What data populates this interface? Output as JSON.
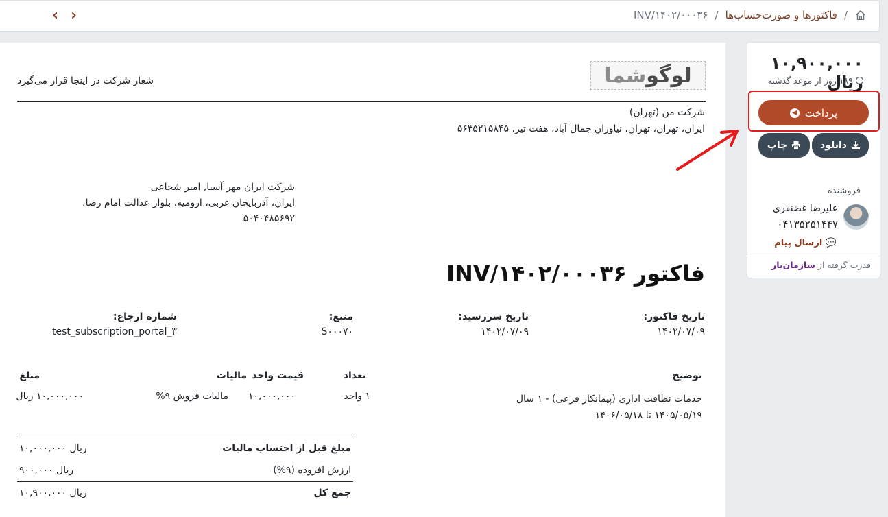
{
  "breadcrumb": {
    "parent": "فاکتورها و صورت‌حساب‌ها",
    "current": "INV/۱۴۰۲/۰۰۰۳۶",
    "separator": "/"
  },
  "nav": {
    "prev": "‹",
    "next": "›"
  },
  "invoice": {
    "logo": {
      "part1": "لوگو",
      "part2": "شما"
    },
    "slogan": "شعار شرکت در اینجا قرار می‌گیرد",
    "company": {
      "name": "شرکت من (تهران)",
      "address": "ایران، تهران، تهران، نیاوران جمال آباد، هفت تیر، ۵۶۳۵۲۱۵۸۴۵"
    },
    "customer": {
      "name": "شرکت ایران مهر آسیا, امیر شجاعی",
      "address": "ایران، آذربایجان غربی، ارومیه، بلوار عدالت امام رضا،",
      "postal": "۵۰۴۰۴۸۵۶۹۲"
    },
    "title": "فاکتور INV/۱۴۰۲/۰۰۰۳۶",
    "meta": [
      {
        "label": "تاریخ فاکتور:",
        "value": "۱۴۰۲/۰۷/۰۹"
      },
      {
        "label": "تاریخ سررسید:",
        "value": "۱۴۰۲/۰۷/۰۹"
      },
      {
        "label": "منبع:",
        "value": "S۰۰۰۷۰"
      },
      {
        "label": "شماره ارجاع:",
        "value": "test_subscription_portal_۳"
      }
    ],
    "columns": {
      "description": "توضیح",
      "qty": "تعداد",
      "unit_price": "قیمت واحد",
      "tax": "مالیات",
      "amount": "مبلغ"
    },
    "line": {
      "description": "خدمات نظافت اداری (پیمانکار فرعی) - ۱ سال",
      "period": "۱۴۰۵/۰۵/۱۹ تا ۱۴۰۶/۰۵/۱۸",
      "qty": "۱ واحد",
      "unit_price": "۱۰,۰۰۰,۰۰۰",
      "tax": "مالیات فروش ۹%",
      "amount": "۱۰,۰۰۰,۰۰۰ ریال"
    },
    "totals": {
      "untaxed_label": "مبلغ قبل از احتساب مالیات",
      "untaxed_value": "۱۰,۰۰۰,۰۰۰ ریال",
      "vat_label": "ارزش افزوده (۹%)",
      "vat_value": "۹۰۰,۰۰۰ ریال",
      "total_label": "جمع کل",
      "total_value": "۱۰,۹۰۰,۰۰۰ ریال"
    }
  },
  "sidebar": {
    "amount": "۱۰,۹۰۰,۰۰۰ ریال",
    "due": "۱۸۹ روز از موعد گذشته",
    "pay_label": "پرداخت",
    "download_label": "دانلود",
    "print_label": "چاپ",
    "seller_label": "فروشنده",
    "seller_name": "علیرضا غضنفری",
    "seller_phone": "۰۴۱۳۵۲۵۱۴۴۷",
    "message_label": "ارسال پیام",
    "powered_label": "قدرت گرفته از",
    "powered_brand": "سازمان‌یار"
  },
  "colors": {
    "accent": "#b14a28",
    "dark_button": "#3b4856",
    "highlight": "#e31b1b"
  }
}
